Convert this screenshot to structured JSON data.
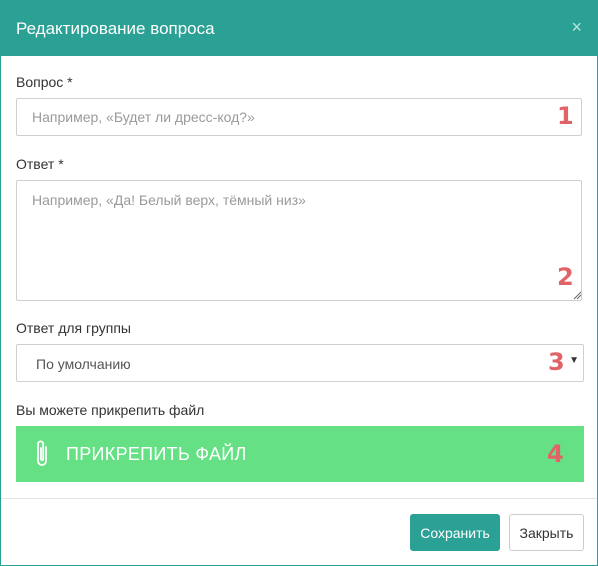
{
  "header": {
    "title": "Редактирование вопроса",
    "close_glyph": "×"
  },
  "question": {
    "label": "Вопрос *",
    "placeholder": "Например, «Будет ли дресс-код?»",
    "value": "",
    "marker": "1"
  },
  "answer": {
    "label": "Ответ *",
    "placeholder": "Например, «Да! Белый верх, тёмный низ»",
    "value": "",
    "marker": "2"
  },
  "group": {
    "label": "Ответ для группы",
    "selected": "По умолчанию",
    "marker": "3"
  },
  "attach": {
    "label": "Вы можете прикрепить файл",
    "button_label": "ПРИКРЕПИТЬ ФАЙЛ",
    "icon": "paperclip-icon",
    "marker": "4"
  },
  "footer": {
    "save_label": "Сохранить",
    "close_label": "Закрыть"
  },
  "colors": {
    "header": "#2aa194",
    "attach_button": "#66e085",
    "marker": "#e06367",
    "save_button": "#2aa194"
  }
}
